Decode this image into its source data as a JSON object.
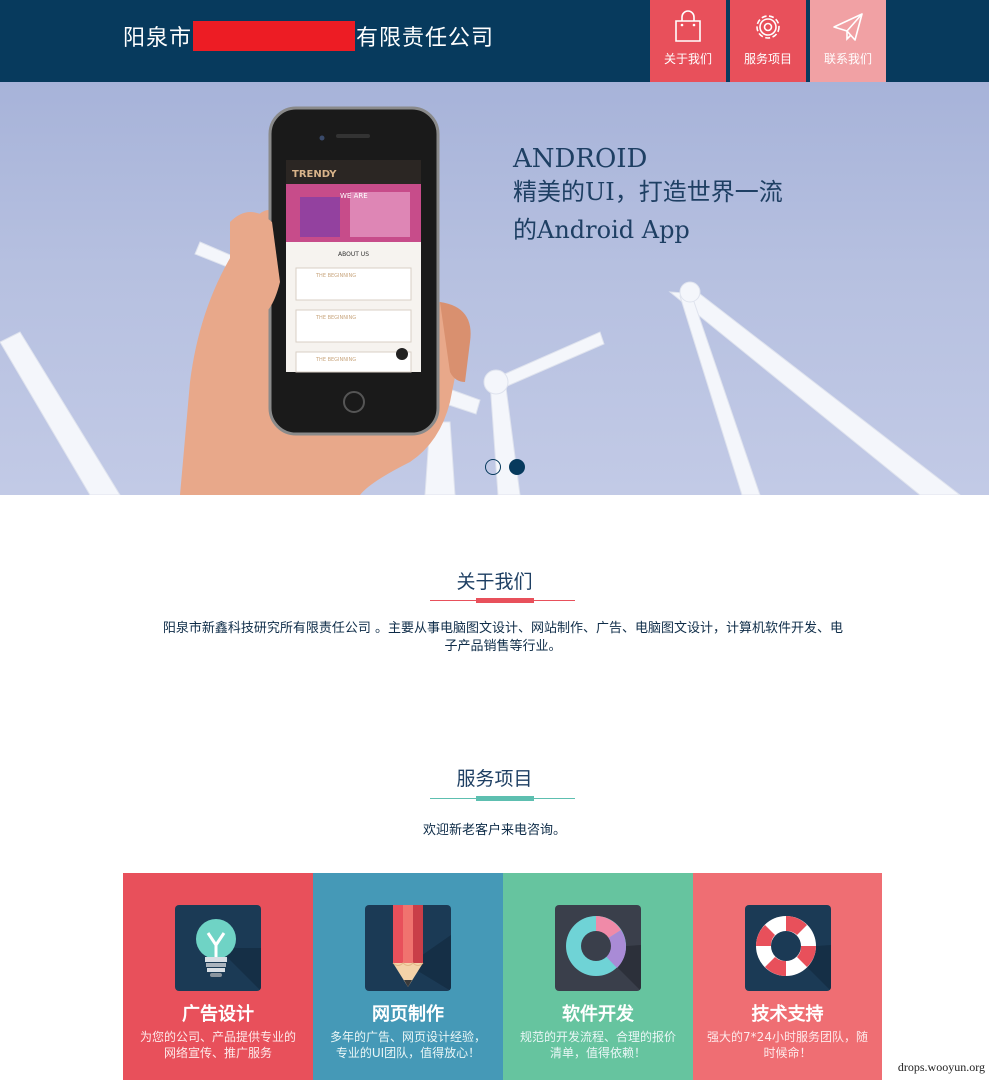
{
  "header": {
    "brand_prefix": "阳泉市",
    "brand_suffix": "有限责任公司",
    "nav": [
      {
        "label": "关于我们",
        "icon": "shopping-bag-icon"
      },
      {
        "label": "服务项目",
        "icon": "gear-icon"
      },
      {
        "label": "联系我们",
        "icon": "paper-plane-icon"
      }
    ]
  },
  "banner": {
    "title": "ANDROID",
    "line1": "精美的UI，打造世界一流",
    "line2": "的Android App",
    "slides": 2,
    "active_slide": 2
  },
  "about": {
    "title": "关于我们",
    "text": "阳泉市新鑫科技研究所有限责任公司 。主要从事电脑图文设计、网站制作、广告、电脑图文设计，计算机软件开发、电子产品销售等行业。"
  },
  "services": {
    "title": "服务项目",
    "subtitle": "欢迎新老客户来电咨询。",
    "cards": [
      {
        "title": "广告设计",
        "desc": "为您的公司、产品提供专业的网络宣传、推广服务",
        "icon": "lightbulb-icon",
        "color": "#e8505b"
      },
      {
        "title": "网页制作",
        "desc": "多年的广告、网页设计经验，专业的UI团队，值得放心！",
        "icon": "pencil-icon",
        "color": "#4599b7"
      },
      {
        "title": "软件开发",
        "desc": "规范的开发流程、合理的报价清单，值得依赖！",
        "icon": "donut-chart-icon",
        "color": "#66c49f"
      },
      {
        "title": "技术支持",
        "desc": "强大的7*24小时服务团队，随时候命！",
        "icon": "lifebuoy-icon",
        "color": "#ef6e73"
      }
    ]
  },
  "watermark": "drops.wooyun.org"
}
